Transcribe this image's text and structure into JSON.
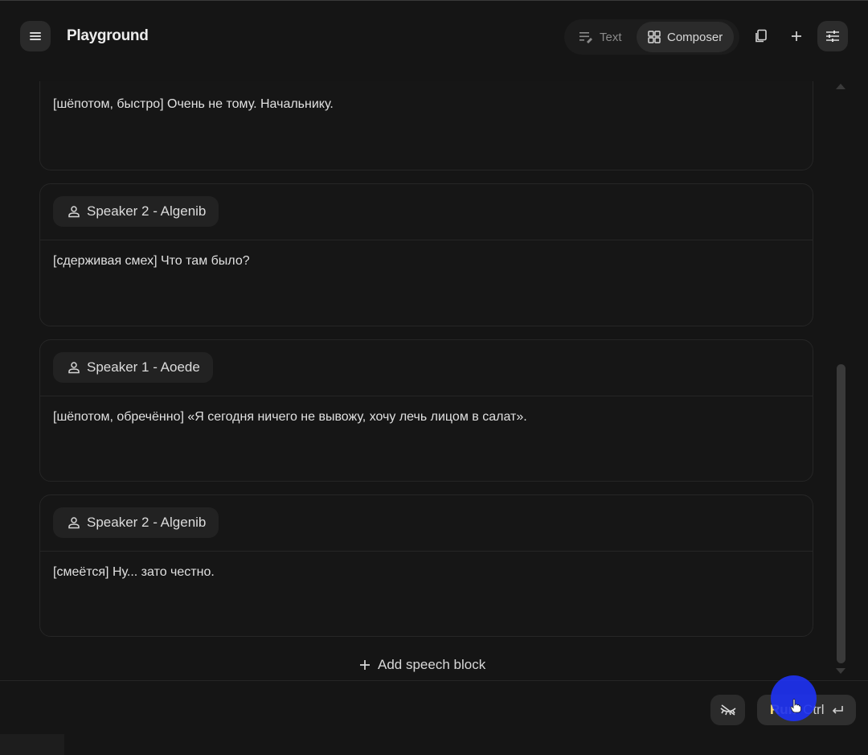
{
  "header": {
    "title": "Playground",
    "menu_icon": "hamburger-menu-icon",
    "modes": [
      {
        "label": "Text",
        "icon": "text-edit-icon",
        "active": false
      },
      {
        "label": "Composer",
        "icon": "grid-icon",
        "active": true
      }
    ],
    "actions": [
      "copy-icon",
      "plus-icon",
      "tune-settings-icon"
    ]
  },
  "blocks": [
    {
      "speaker": null,
      "text": "[шёпотом, быстро] Очень не тому. Начальнику."
    },
    {
      "speaker": "Speaker 2 - Algenib",
      "text": "[сдерживая смех] Что там было?"
    },
    {
      "speaker": "Speaker 1 - Aoede",
      "text": "[шёпотом, обречённо] «Я сегодня ничего не вывожу, хочу лечь лицом в салат»."
    },
    {
      "speaker": "Speaker 2 - Algenib",
      "text": "[смеётся] Ну... зато честно."
    }
  ],
  "add_block_label": "Add speech block",
  "footer": {
    "run_label": "Run",
    "run_shortcut": "Ctrl",
    "run_key_icon": "enter-key-icon",
    "hide_icon": "eye-off-icon"
  },
  "colors": {
    "background": "#151515",
    "run_text": "#ffe27a",
    "click_indicator": "#1e32f0"
  }
}
